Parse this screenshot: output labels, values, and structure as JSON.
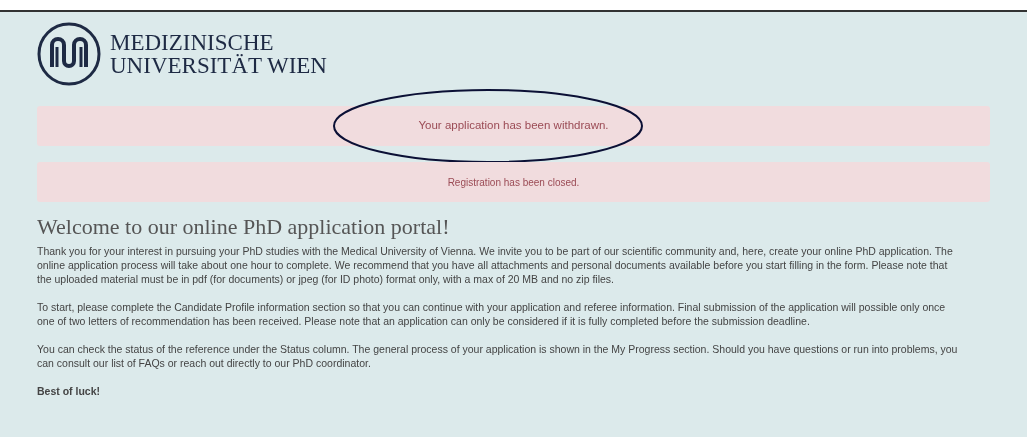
{
  "logo": {
    "line_1": "MEDIZINISCHE",
    "line_2": "UNIVERSITÄT WIEN"
  },
  "alerts": [
    {
      "text": "Your application has been withdrawn.",
      "circled": true
    },
    {
      "text": "Registration has been closed.",
      "circled": false
    }
  ],
  "heading": "Welcome to our online PhD application portal!",
  "paragraphs": [
    "Thank you for your interest in pursuing your PhD studies with the Medical University of Vienna. We invite you to be part of our scientific community and, here, create your online PhD application. The online application process will take about one hour to complete. We recommend that you have all attachments and personal documents available before you start filling in the form. Please note that the uploaded material must be in pdf (for documents) or jpeg (for ID photo) format only, with a max of 20 MB and no zip files.",
    "To start, please complete the Candidate Profile information section so that you can continue with your application and referee information. Final submission of the application will possible only once one of two letters of recommendation has been received. Please note that an application can only be considered if it is fully completed before the submission deadline.",
    "You can check the status of the reference under the Status column. The general process of your application is shown in the My Progress section. Should you have questions or run into problems, you can consult our list of FAQs or reach out directly to our PhD coordinator.",
    "Best of luck!"
  ]
}
